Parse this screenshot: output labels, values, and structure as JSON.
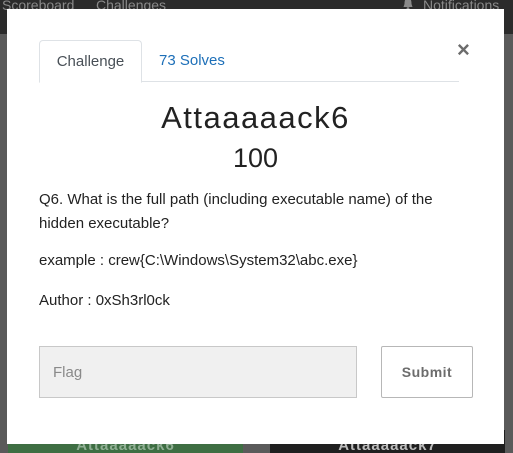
{
  "background": {
    "nav": {
      "scoreboard": "Scoreboard",
      "challenges": "Challenges",
      "notifications": "Notifications"
    },
    "tiles": [
      "Attaaaaack6",
      "Attaaaaack7"
    ]
  },
  "modal": {
    "tabs": [
      {
        "label": "Challenge"
      },
      {
        "label": "73 Solves"
      }
    ],
    "close": "×",
    "title": "Attaaaaack6",
    "value": "100",
    "description": "Q6. What is the full path (including executable name) of the hidden executable?",
    "example": "example : crew{C:\\Windows\\System32\\abc.exe}",
    "author": "Author : 0xSh3rl0ck",
    "flag_placeholder": "Flag",
    "flag_value": "",
    "submit_label": "Submit"
  },
  "colors": {
    "accent_link": "#1d6fb8",
    "overlay": "#5a5a5a",
    "navbar": "#2b2b2b"
  },
  "icons": {
    "nav_notifications": "bell-icon"
  }
}
